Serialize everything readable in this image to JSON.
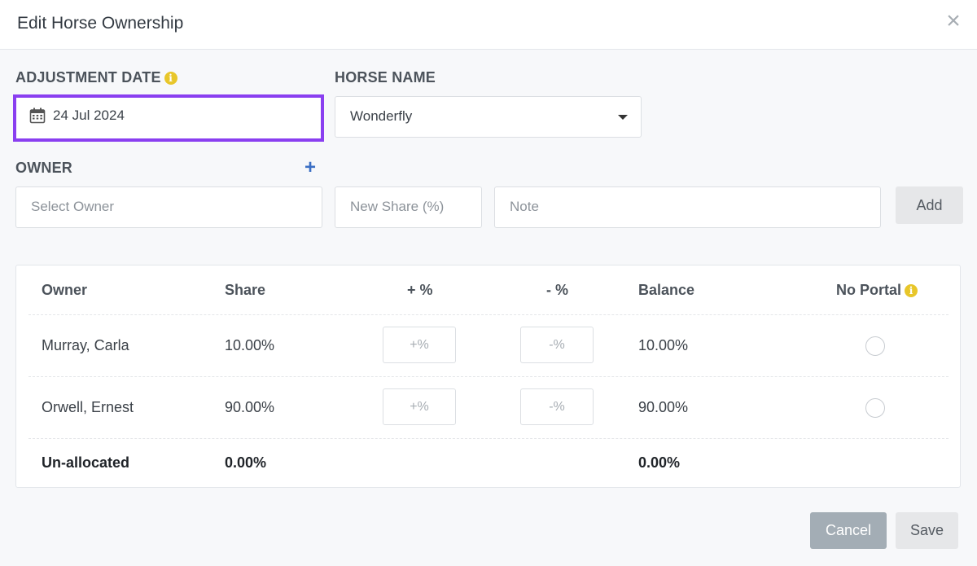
{
  "modal": {
    "title": "Edit Horse Ownership"
  },
  "form": {
    "adjustment_date_label": "ADJUSTMENT DATE",
    "adjustment_date_value": "24 Jul 2024",
    "horse_name_label": "HORSE NAME",
    "horse_name_value": "Wonderfly",
    "owner_label": "OWNER",
    "owner_placeholder": "Select Owner",
    "new_share_placeholder": "New Share (%)",
    "note_placeholder": "Note",
    "add_label": "Add"
  },
  "table": {
    "headers": {
      "owner": "Owner",
      "share": "Share",
      "plus": "+ %",
      "minus": "- %",
      "balance": "Balance",
      "no_portal": "No Portal"
    },
    "rows": [
      {
        "owner": "Murray, Carla",
        "share": "10.00%",
        "plus_placeholder": "+%",
        "minus_placeholder": "-%",
        "balance": "10.00%"
      },
      {
        "owner": "Orwell, Ernest",
        "share": "90.00%",
        "plus_placeholder": "+%",
        "minus_placeholder": "-%",
        "balance": "90.00%"
      }
    ],
    "footer": {
      "label": "Un-allocated",
      "share": "0.00%",
      "balance": "0.00%"
    }
  },
  "actions": {
    "cancel": "Cancel",
    "save": "Save"
  },
  "colors": {
    "accent_focus": "#8a3ff0",
    "info_icon": "#e8c62a",
    "plus_icon": "#3b6fc4"
  }
}
